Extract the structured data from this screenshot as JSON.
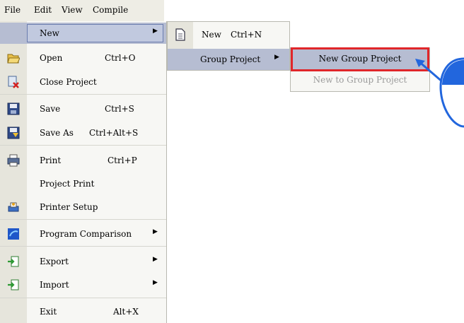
{
  "menubar": {
    "items": [
      "File",
      "Edit",
      "View",
      "Compile"
    ]
  },
  "file_menu": {
    "items": [
      {
        "label": "New",
        "shortcut": "",
        "submenu": true,
        "icon": "none"
      },
      {
        "label": "Open",
        "shortcut": "Ctrl+O",
        "submenu": false,
        "icon": "open-folder-icon"
      },
      {
        "label": "Close Project",
        "shortcut": "",
        "submenu": false,
        "icon": "close-project-icon"
      },
      {
        "label": "Save",
        "shortcut": "Ctrl+S",
        "submenu": false,
        "icon": "save-disk-icon"
      },
      {
        "label": "Save As",
        "shortcut": "Ctrl+Alt+S",
        "submenu": false,
        "icon": "save-as-icon"
      },
      {
        "label": "Print",
        "shortcut": "Ctrl+P",
        "submenu": false,
        "icon": "printer-icon"
      },
      {
        "label": "Project Print",
        "shortcut": "",
        "submenu": false,
        "icon": "none"
      },
      {
        "label": "Printer Setup",
        "shortcut": "",
        "submenu": false,
        "icon": "printer-setup-icon"
      },
      {
        "label": "Program Comparison",
        "shortcut": "",
        "submenu": true,
        "icon": "compare-icon"
      },
      {
        "label": "Export",
        "shortcut": "",
        "submenu": true,
        "icon": "export-icon"
      },
      {
        "label": "Import",
        "shortcut": "",
        "submenu": true,
        "icon": "import-icon"
      },
      {
        "label": "Exit",
        "shortcut": "Alt+X",
        "submenu": false,
        "icon": "none"
      }
    ]
  },
  "new_submenu": {
    "items": [
      {
        "label": "New",
        "shortcut": "Ctrl+N",
        "submenu": false,
        "icon": "new-document-icon"
      },
      {
        "label": "Group Project",
        "shortcut": "",
        "submenu": true
      }
    ]
  },
  "group_project_submenu": {
    "items": [
      {
        "label": "New Group Project",
        "enabled": true
      },
      {
        "label": "New to Group Project",
        "enabled": false
      }
    ]
  },
  "colors": {
    "highlight": "#b6bdd2",
    "callout_border": "#e0262a",
    "pointer_blue": "#2266dd"
  }
}
